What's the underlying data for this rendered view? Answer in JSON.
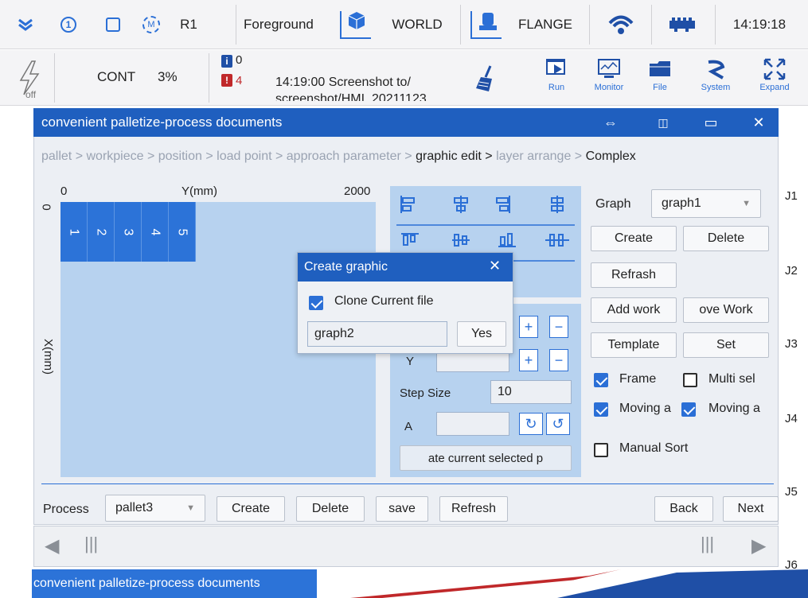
{
  "topbar": {
    "items": [
      "R1",
      "Foreground",
      "WORLD",
      "FLANGE"
    ],
    "time": "14:19:18",
    "icons": [
      "chevron-down-icon",
      "circle-one-icon",
      "square-icon",
      "m-circle-icon",
      "cube-axis-icon",
      "flange-axis-icon",
      "signal-icon",
      "io-icon"
    ]
  },
  "secbar": {
    "mode": "CONT",
    "speed": "3%",
    "info_count": "0",
    "error_count": "4",
    "message_line1": "14:19:00 Screenshot to/",
    "message_line2": "screenshot/HMI_20211123",
    "tools": [
      "Run",
      "Monitor",
      "File",
      "System",
      "Expand"
    ]
  },
  "window": {
    "title": "convenient palletize-process documents",
    "breadcrumb": {
      "steps": [
        "pallet",
        "workpiece",
        "position",
        "load point",
        "approach parameter",
        "graphic edit",
        "layer arrange",
        "Complex"
      ],
      "active": "graphic edit"
    }
  },
  "canvas": {
    "origin": "0",
    "y_label": "Y(mm)",
    "y_max": "2000",
    "x_label": "X(mm)",
    "x_origin": "0",
    "cells": [
      "1",
      "2",
      "3",
      "4",
      "5"
    ]
  },
  "align_tools": [
    "align-left-icon",
    "align-center-h-icon",
    "align-right-icon",
    "align-distribute-h-icon",
    "align-top-icon",
    "align-middle-v-icon",
    "align-bottom-icon",
    "align-distribute-v-icon"
  ],
  "position_panel": {
    "y_label": "Y",
    "step_label": "Step Size",
    "step_value": "10",
    "a_label": "A",
    "rotate_button": "ate current selected p"
  },
  "right_panel": {
    "graph_label": "Graph",
    "graph_value": "graph1",
    "buttons": {
      "create": "Create",
      "delete": "Delete",
      "refresh": "Refrash",
      "add_work": "Add work",
      "remove_work": "ove Work",
      "template": "Template",
      "set": "Set"
    },
    "checks": [
      {
        "label": "Frame",
        "checked": true
      },
      {
        "label": "Multi sel",
        "checked": false
      },
      {
        "label": "Moving a",
        "checked": true
      },
      {
        "label": "Moving a",
        "checked": true
      },
      {
        "label": "Manual Sort",
        "checked": false
      }
    ]
  },
  "popup": {
    "title": "Create graphic",
    "clone_label": "Clone Current file",
    "clone_checked": true,
    "name_value": "graph2",
    "yes": "Yes"
  },
  "bottom_bar": {
    "process_label": "Process",
    "process_value": "pallet3",
    "create": "Create",
    "delete": "Delete",
    "save": "save",
    "refresh": "Refresh",
    "back": "Back",
    "next": "Next"
  },
  "joints": [
    "J1",
    "J2",
    "J3",
    "J4",
    "J5",
    "J6"
  ],
  "taskbar": {
    "item": "convenient palletize-process documents"
  },
  "colors": {
    "accent": "#1f5fbf",
    "cell": "#2c73d8",
    "canvas": "#b7d2ef",
    "error": "#c0282a"
  }
}
